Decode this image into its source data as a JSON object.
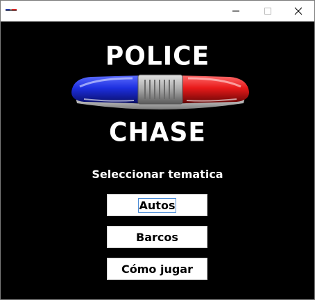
{
  "window": {
    "controls": {
      "minimize_icon": "minimize-icon",
      "maximize_icon": "maximize-icon",
      "close_icon": "close-icon"
    }
  },
  "logo": {
    "top_text": "POLICE",
    "bottom_text": "CHASE",
    "colors": {
      "blue": "#1d2fe0",
      "red": "#e81a1a",
      "silver": "#b8b8b8"
    }
  },
  "menu": {
    "subtitle": "Seleccionar tematica",
    "buttons": [
      {
        "label": "Autos"
      },
      {
        "label": "Barcos"
      },
      {
        "label": "Cómo jugar"
      }
    ]
  }
}
